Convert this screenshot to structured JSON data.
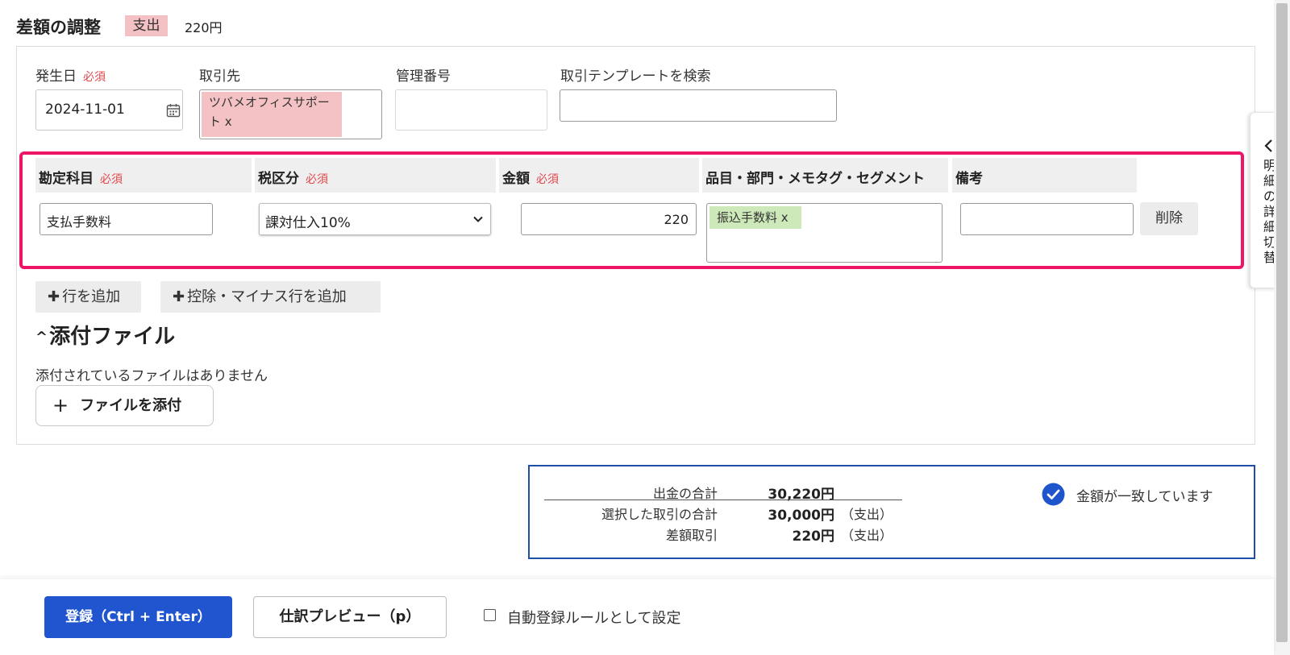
{
  "header": {
    "title": "差額の調整",
    "type_badge": "支出",
    "amount": "220円"
  },
  "form": {
    "date": {
      "label": "発生日",
      "required": "必須",
      "value": "2024-11-01"
    },
    "partner": {
      "label": "取引先",
      "tag": "ツバメオフィスサポート x"
    },
    "management_no": {
      "label": "管理番号",
      "value": ""
    },
    "template_search": {
      "label": "取引テンプレートを検索",
      "value": ""
    }
  },
  "detail": {
    "headers": {
      "account": "勘定科目",
      "tax": "税区分",
      "amount": "金額",
      "item": "品目・部門・メモタグ・セグメント",
      "memo": "備考",
      "required": "必須"
    },
    "row": {
      "account": "支払手数料",
      "tax": "課対仕入10%",
      "amount": "220",
      "item_tag": "振込手数料 x",
      "memo": "",
      "delete_label": "削除"
    }
  },
  "actions": {
    "add_row": "行を追加",
    "add_minus_row": "控除・マイナス行を追加"
  },
  "attachments": {
    "heading": "添付ファイル",
    "empty": "添付されているファイルはありません",
    "add_label": "ファイルを添付"
  },
  "summary": {
    "rows": [
      {
        "label": "出金の合計",
        "value": "30,220円",
        "note": ""
      },
      {
        "label": "選択した取引の合計",
        "value": "30,000円",
        "note": "（支出）"
      },
      {
        "label": "差額取引",
        "value": "220円",
        "note": "（支出）"
      }
    ],
    "match_text": "金額が一致しています"
  },
  "drawer": {
    "label": "明細の詳細切替"
  },
  "footer": {
    "submit_label": "登録（Ctrl + Enter）",
    "preview_label": "仕訳プレビュー（p）",
    "auto_rule_label": "自動登録ルールとして設定"
  },
  "colors": {
    "accent": "#ec1566",
    "primary": "#2155d0",
    "summary_border": "#1d4ea8",
    "expense_badge": "#f4c1c4",
    "item_tag": "#cde8b9"
  },
  "icons": [
    "calendar-icon",
    "chevron-down-icon",
    "plus-icon",
    "caret-up-icon",
    "check-circle-icon",
    "chevron-left-icon"
  ]
}
